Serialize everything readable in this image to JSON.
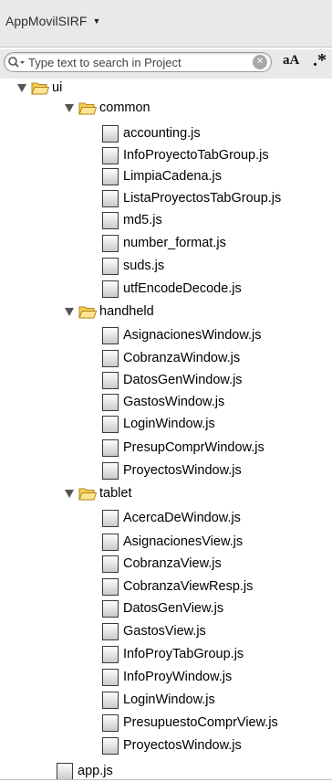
{
  "header": {
    "project_name": "AppMovilSIRF",
    "selector_caret": "▼"
  },
  "search": {
    "placeholder": "Type text to search in Project",
    "clear_glyph": "✕",
    "case_label": "aA",
    "regex_label": ".*"
  },
  "tree": {
    "ui": {
      "label": "ui",
      "common": {
        "label": "common",
        "files": [
          "accounting.js",
          "InfoProyectoTabGroup.js",
          "LimpiaCadena.js",
          "ListaProyectosTabGroup.js",
          "md5.js",
          "number_format.js",
          "suds.js",
          "utfEncodeDecode.js"
        ]
      },
      "handheld": {
        "label": "handheld",
        "files": [
          "AsignacionesWindow.js",
          "CobranzaWindow.js",
          "DatosGenWindow.js",
          "GastosWindow.js",
          "LoginWindow.js",
          "PresupComprWindow.js",
          "ProyectosWindow.js"
        ]
      },
      "tablet": {
        "label": "tablet",
        "files": [
          "AcercaDeWindow.js",
          "AsignacionesView.js",
          "CobranzaView.js",
          "CobranzaViewResp.js",
          "DatosGenView.js",
          "GastosView.js",
          "InfoProyTabGroup.js",
          "InfoProyWindow.js",
          "LoginWindow.js",
          "PresupuestoComprView.js",
          "ProyectosWindow.js"
        ]
      }
    },
    "root_files": [
      "app.js"
    ]
  }
}
